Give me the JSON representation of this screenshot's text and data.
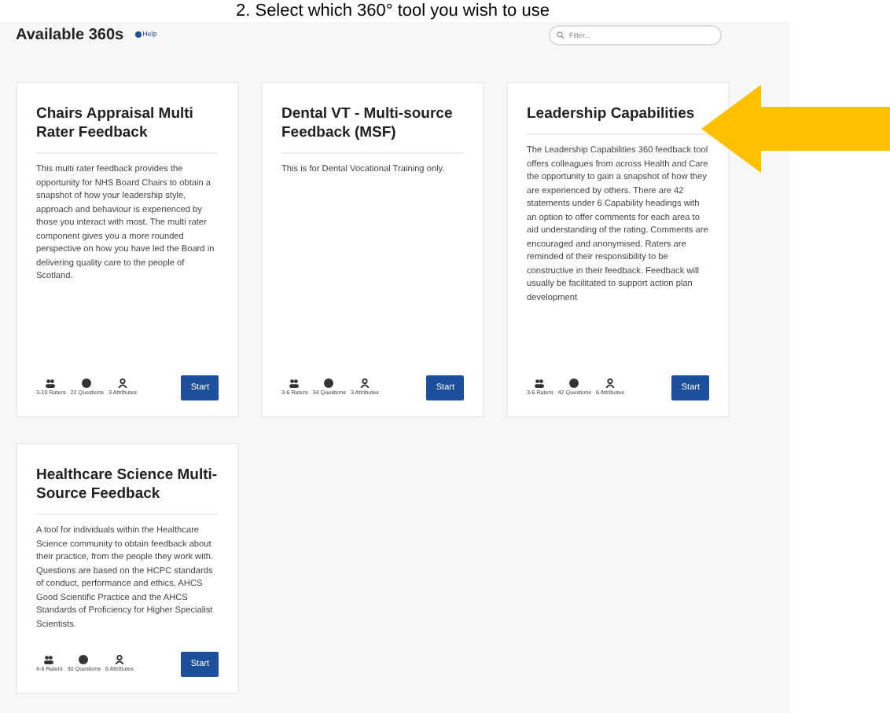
{
  "instruction": "2.  Select which 360° tool you wish to use",
  "header": {
    "title": "Available 360s",
    "help": "Help",
    "search": {
      "placeholder": "Filter..."
    }
  },
  "cards": [
    {
      "title": "Chairs Appraisal Multi Rater Feedback",
      "description": "This multi rater feedback provides the opportunity for NHS Board Chairs to obtain a snapshot of how your leadership style, approach and behaviour is experienced by those you interact with most. The multi rater component gives you a more rounded perspective on how you have led the Board in delivering quality care to the people of Scotland.",
      "stats": [
        "3-10 Raters",
        "22 Questions",
        "3 Attributes"
      ],
      "button": "Start"
    },
    {
      "title": "Dental VT - Multi-source Feedback (MSF)",
      "description": "This is for Dental Vocational Training only.",
      "stats": [
        "3-6 Raters",
        "34 Questions",
        "3 Attributes"
      ],
      "button": "Start"
    },
    {
      "title": "Leadership Capabilities",
      "description": "The Leadership Capabilities 360 feedback tool offers colleagues from across Health and Care the opportunity to gain a snapshot of how they are experienced by others. There are 42 statements under 6 Capability headings with an option to offer comments for each area to aid understanding of the rating. Comments are encouraged and anonymised. Raters are reminded of their responsibility to be constructive in their feedback. Feedback will usually be facilitated to support action plan development",
      "stats": [
        "3-6 Raters",
        "42 Questions",
        "6 Attributes"
      ],
      "button": "Start"
    },
    {
      "title": "Healthcare Science Multi-Source Feedback",
      "description": "A tool for individuals within the Healthcare Science community to obtain feedback about their practice, from the people they work with. Questions are based on the HCPC standards of conduct, performance and ethics, AHCS Good Scientific Practice and the AHCS Standards of Proficiency for Higher Specialist Scientists.",
      "stats": [
        "4-6 Raters",
        "30 Questions",
        "6 Attributes"
      ],
      "button": "Start"
    }
  ]
}
